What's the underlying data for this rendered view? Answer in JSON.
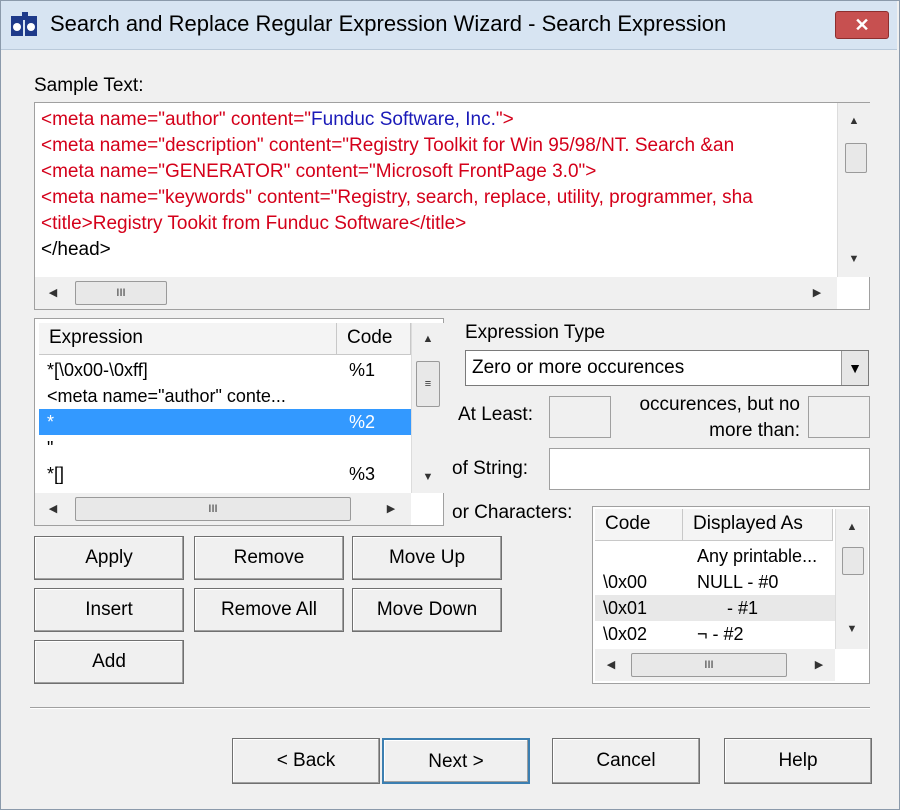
{
  "window": {
    "title": "Search and Replace Regular Expression Wizard - Search Expression",
    "close_icon": "x-icon"
  },
  "sample": {
    "label": "Sample Text:",
    "lines": [
      {
        "a": "<meta name=\"author\" content=\"",
        "b": "Funduc Software, Inc.",
        "c": "\">"
      },
      {
        "a": "<meta name=\"description\" content=\"Registry Toolkit for Win 95/98/NT. Search &an",
        "b": "",
        "c": ""
      },
      {
        "a": "<meta name=\"GENERATOR\" content=\"Microsoft FrontPage 3.0\">",
        "b": "",
        "c": ""
      },
      {
        "a": "<meta name=\"keywords\" content=\"Registry, search, replace, utility, programmer, sha",
        "b": "",
        "c": ""
      },
      {
        "a": "<title>Registry Tookit from Funduc Software</title>",
        "b": "",
        "c": ""
      },
      {
        "a": "</head>",
        "b": "",
        "c": ""
      }
    ]
  },
  "expressions": {
    "headers": {
      "expression": "Expression",
      "code": "Code"
    },
    "rows": [
      {
        "expression": "*[\\0x00-\\0xff]",
        "code": "%1"
      },
      {
        "expression": "<meta name=\"author\" conte...",
        "code": ""
      },
      {
        "expression": "*",
        "code": "%2"
      },
      {
        "expression": "\"",
        "code": ""
      },
      {
        "expression": "*[]",
        "code": "%3"
      }
    ]
  },
  "expression_type": {
    "label": "Expression Type",
    "selected": "Zero or more occurences",
    "at_least_label": "At Least:",
    "occurrences_label_1": "occurences, but no",
    "occurrences_label_2": "more than:",
    "string_label": "of String:",
    "chars_label": "or Characters:"
  },
  "characters": {
    "headers": {
      "code": "Code",
      "displayed": "Displayed As"
    },
    "rows": [
      {
        "code": "",
        "displayed": "Any printable..."
      },
      {
        "code": "\\0x00",
        "displayed": "NULL - #0"
      },
      {
        "code": "\\0x01",
        "displayed": "      - #1"
      },
      {
        "code": "\\0x02",
        "displayed": "¬ - #2"
      }
    ]
  },
  "buttons": {
    "apply": "Apply",
    "remove": "Remove",
    "move_up": "Move Up",
    "insert": "Insert",
    "remove_all": "Remove All",
    "move_down": "Move Down",
    "add": "Add",
    "back": "< Back",
    "next": "Next >",
    "cancel": "Cancel",
    "help": "Help"
  },
  "scroll": {
    "grip": "III",
    "up": "▲",
    "down": "▼",
    "left": "◀",
    "right": "▶"
  },
  "colors": {
    "selection": "#3399ff",
    "sample_red": "#d4001a",
    "sample_blue": "#1a1ab8"
  }
}
